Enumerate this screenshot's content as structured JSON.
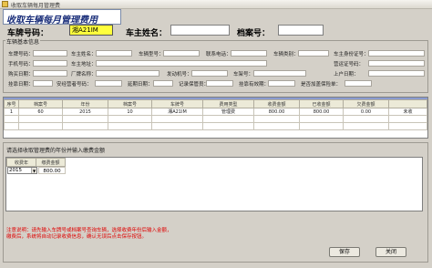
{
  "window": {
    "title": "收取车辆每月管理费"
  },
  "form_title": "收取车辆每月管理费用",
  "search": {
    "plate_label": "车牌号码：",
    "plate_value": "湘A21IM",
    "owner_label": "车主姓名：",
    "owner_value": "",
    "file_label": "档案号：",
    "file_value": ""
  },
  "vehicle_info": {
    "group_label": "车辆基本信息",
    "rows": [
      [
        "车牌号码：",
        "车主姓名：",
        "车辆型号：",
        "联系电话：",
        "车辆类别：",
        "车主身份证号："
      ],
      [
        "手机号码：",
        "车主地址：",
        "",
        "",
        "营运证号码：",
        ""
      ],
      [
        "购买日期：",
        "厂牌名称：",
        "",
        "发动机号：",
        "车架号：",
        "上户日期："
      ],
      [
        "挂靠日期：",
        "安经营者号码：",
        "延期日期：",
        "记录保管员：",
        "挂靠有效期：",
        "是否加盖保险单："
      ]
    ]
  },
  "fee_table": {
    "headers": [
      "序号",
      "档案号",
      "年份",
      "档案号",
      "车牌号",
      "费用类型",
      "收费金额",
      "已收金额",
      "欠费金额",
      ""
    ],
    "rows": [
      [
        "1",
        "60",
        "2015",
        "10",
        "湘A21IM",
        "管理费",
        "800.00",
        "800.00",
        "0.00",
        "未收"
      ]
    ]
  },
  "lower_panel": {
    "instruction": "请选择收取管理费的年份并输入缴费金额",
    "headers": [
      "收费年",
      "缴费金额"
    ],
    "year_value": "2015",
    "amount_value": "800.00"
  },
  "notes": {
    "line1": "注意说明：请先输入车牌号或档案号查询车辆，选择收费年份后输入金额，",
    "line2": "缴费后，系统将自动记录收费信息，确认无误后点击保存按钮。"
  },
  "buttons": {
    "save": "保存",
    "close": "关闭"
  }
}
